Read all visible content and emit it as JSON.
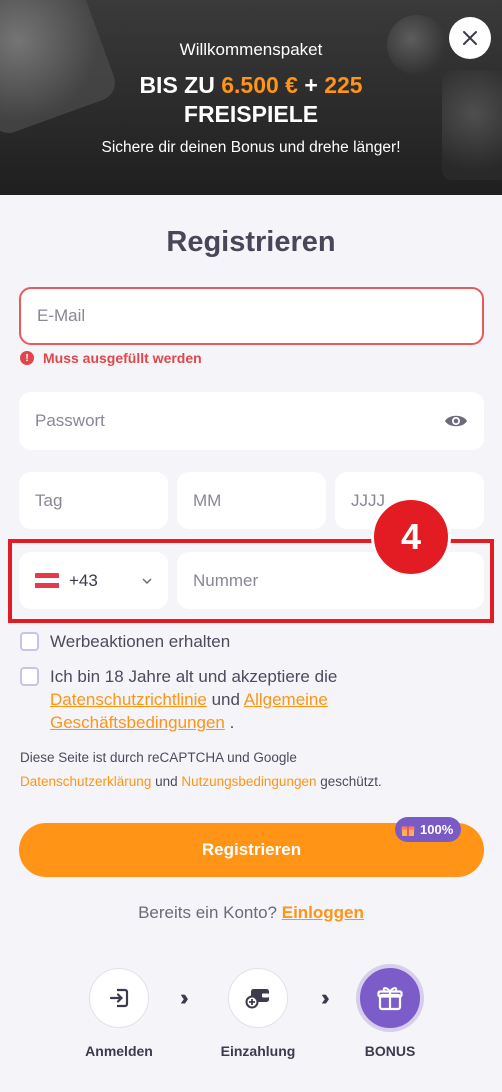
{
  "hero": {
    "topline": "Willkommenspaket",
    "title_prefix": "BIS ZU ",
    "title_amount": "6.500 €",
    "title_plus": " + ",
    "title_spins": "225",
    "title_line2": "FREISPIELE",
    "subtitle": "Sichere dir deinen Bonus und drehe länger!"
  },
  "title": "Registrieren",
  "form": {
    "email_placeholder": "E-Mail",
    "email_error": "Muss ausgefüllt werden",
    "password_placeholder": "Passwort",
    "day_placeholder": "Tag",
    "month_placeholder": "MM",
    "year_placeholder": "JJJJ",
    "country_code": "+43",
    "number_placeholder": "Nummer"
  },
  "annotation": "4",
  "checkboxes": {
    "promo_label": "Werbeaktionen erhalten",
    "terms_prefix": "Ich bin 18 Jahre alt und akzeptiere die ",
    "privacy_link": "Datenschutzrichtlinie",
    "and": " und ",
    "terms_link": "Allgemeine Geschäftsbedingungen",
    "terms_suffix": " ."
  },
  "captcha": {
    "line1": "Diese Seite ist durch reCAPTCHA und Google",
    "privacy_link": "Datenschutzerklärung",
    "and": " und ",
    "terms_link": "Nutzungsbedingungen",
    "suffix": " geschützt."
  },
  "register_button": "Registrieren",
  "bonus_pill": "100%",
  "login": {
    "prompt": "Bereits ein Konto? ",
    "link": "Einloggen"
  },
  "steps": [
    {
      "label": "Anmelden",
      "icon": "login-icon"
    },
    {
      "label": "Einzahlung",
      "icon": "deposit-icon"
    },
    {
      "label": "BONUS",
      "icon": "gift-icon"
    }
  ],
  "colors": {
    "accent": "#ff9416",
    "error": "#e0474d",
    "highlight": "#e31c23",
    "bonus_purple": "#7b5cc9"
  }
}
